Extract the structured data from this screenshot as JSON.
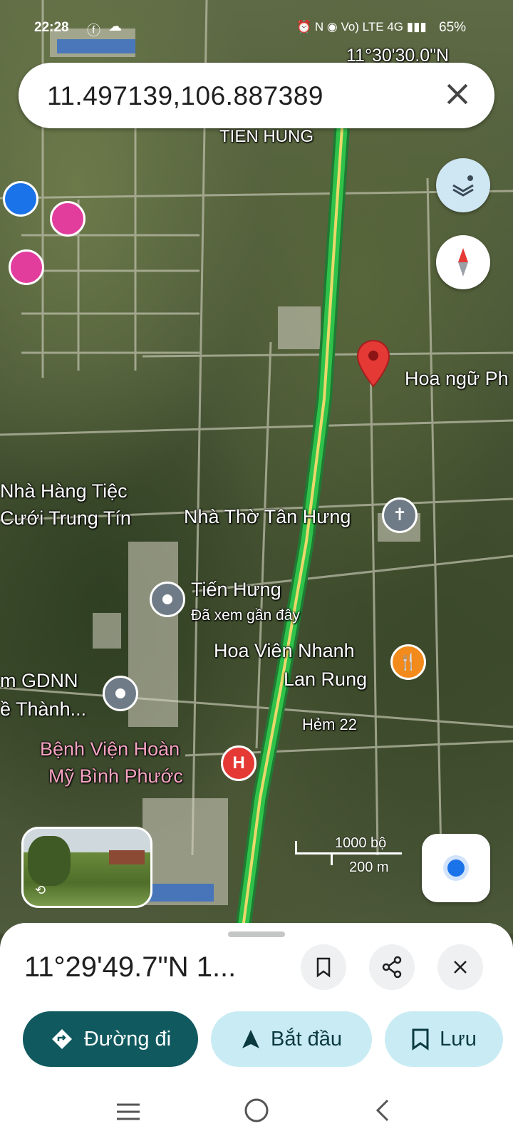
{
  "status_bar": {
    "time": "22:28",
    "icons_right": "⏰ N ◉ Vo) LTE 4G ▮▮▮",
    "battery": "65%"
  },
  "search": {
    "value": "11.497139,106.887389"
  },
  "map": {
    "coord_overlay": "11°30'30.0\"N",
    "road_label_top": "TIEN HUNG",
    "dropped_pin_label": "Hoa ngữ Ph",
    "places": {
      "restaurant_wedding_1": "Nhà Hàng Tiệc",
      "restaurant_wedding_2": "Cưới Trung Tín",
      "church": "Nhà Thờ Tân Hưng",
      "tien_hung": "Tiến Hưng",
      "tien_hung_sub": "Đã xem gần đây",
      "hoa_vien_1": "Hoa Viên Nhanh",
      "hoa_vien_2": "Lan Rung",
      "gdnn_1": "m GDNN",
      "gdnn_2": "ề Thành...",
      "hospital_1": "Bệnh Viện Hoàn",
      "hospital_2": "Mỹ Bình Phước",
      "alley": "Hẻm 22"
    },
    "scale": {
      "imperial": "1000 bộ",
      "metric": "200 m"
    },
    "colors": {
      "route": "#2fc24a",
      "pin": "#e53935",
      "hotel": "#e23d9d",
      "hospital": "#e53935",
      "food": "#f28a1c",
      "fab_bg": "#cfe6f3"
    }
  },
  "sheet": {
    "title": "11°29'49.7\"N 1...",
    "directions_label": "Đường đi",
    "start_label": "Bắt đầu",
    "save_label": "Lưu"
  },
  "icons": [
    "search-clear-icon",
    "layers-icon",
    "compass-icon",
    "my-location-icon",
    "bookmark-icon",
    "share-icon",
    "close-icon",
    "directions-icon",
    "navigation-icon",
    "recents-icon",
    "home-icon",
    "back-icon"
  ]
}
